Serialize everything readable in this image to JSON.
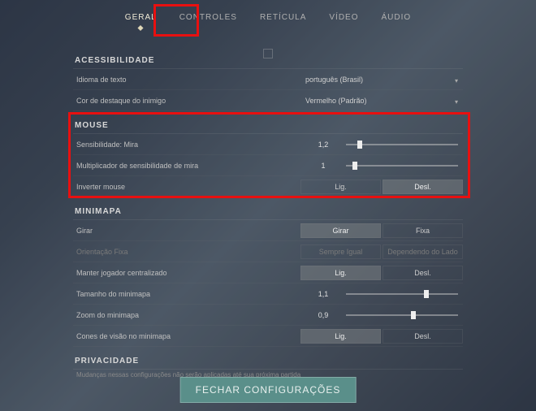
{
  "tabs": {
    "items": [
      {
        "label": "GERAL",
        "active": true
      },
      {
        "label": "CONTROLES",
        "active": false
      },
      {
        "label": "RETÍCULA",
        "active": false
      },
      {
        "label": "VÍDEO",
        "active": false
      },
      {
        "label": "ÁUDIO",
        "active": false
      }
    ]
  },
  "sections": {
    "acess": {
      "title": "ACESSIBILIDADE",
      "lang_label": "Idioma de texto",
      "lang_value": "português (Brasil)",
      "highlight_label": "Cor de destaque do inimigo",
      "highlight_value": "Vermelho (Padrão)"
    },
    "mouse": {
      "title": "MOUSE",
      "sens_label": "Sensibilidade: Mira",
      "sens_value": "1,2",
      "sens_pct": 12,
      "mult_label": "Multiplicador de sensibilidade de mira",
      "mult_value": "1",
      "mult_pct": 8,
      "invert_label": "Inverter mouse",
      "invert_on": "Lig.",
      "invert_off": "Desl.",
      "invert_selected": "off"
    },
    "minimap": {
      "title": "MINIMAPA",
      "rotate_label": "Girar",
      "rotate_a": "Girar",
      "rotate_b": "Fixa",
      "orient_label": "Orientação Fixa",
      "orient_a": "Sempre Igual",
      "orient_b": "Dependendo do Lado",
      "center_label": "Manter jogador centralizado",
      "center_on": "Lig.",
      "center_off": "Desl.",
      "size_label": "Tamanho do minimapa",
      "size_value": "1,1",
      "size_pct": 72,
      "zoom_label": "Zoom do minimapa",
      "zoom_value": "0,9",
      "zoom_pct": 60,
      "cones_label": "Cones de visão no minimapa",
      "cones_on": "Lig.",
      "cones_off": "Desl."
    },
    "priv": {
      "title": "PRIVACIDADE",
      "note": "Mudanças nessas configurações não serão aplicadas até sua próxima partida"
    }
  },
  "close_label": "FECHAR CONFIGURAÇÕES"
}
